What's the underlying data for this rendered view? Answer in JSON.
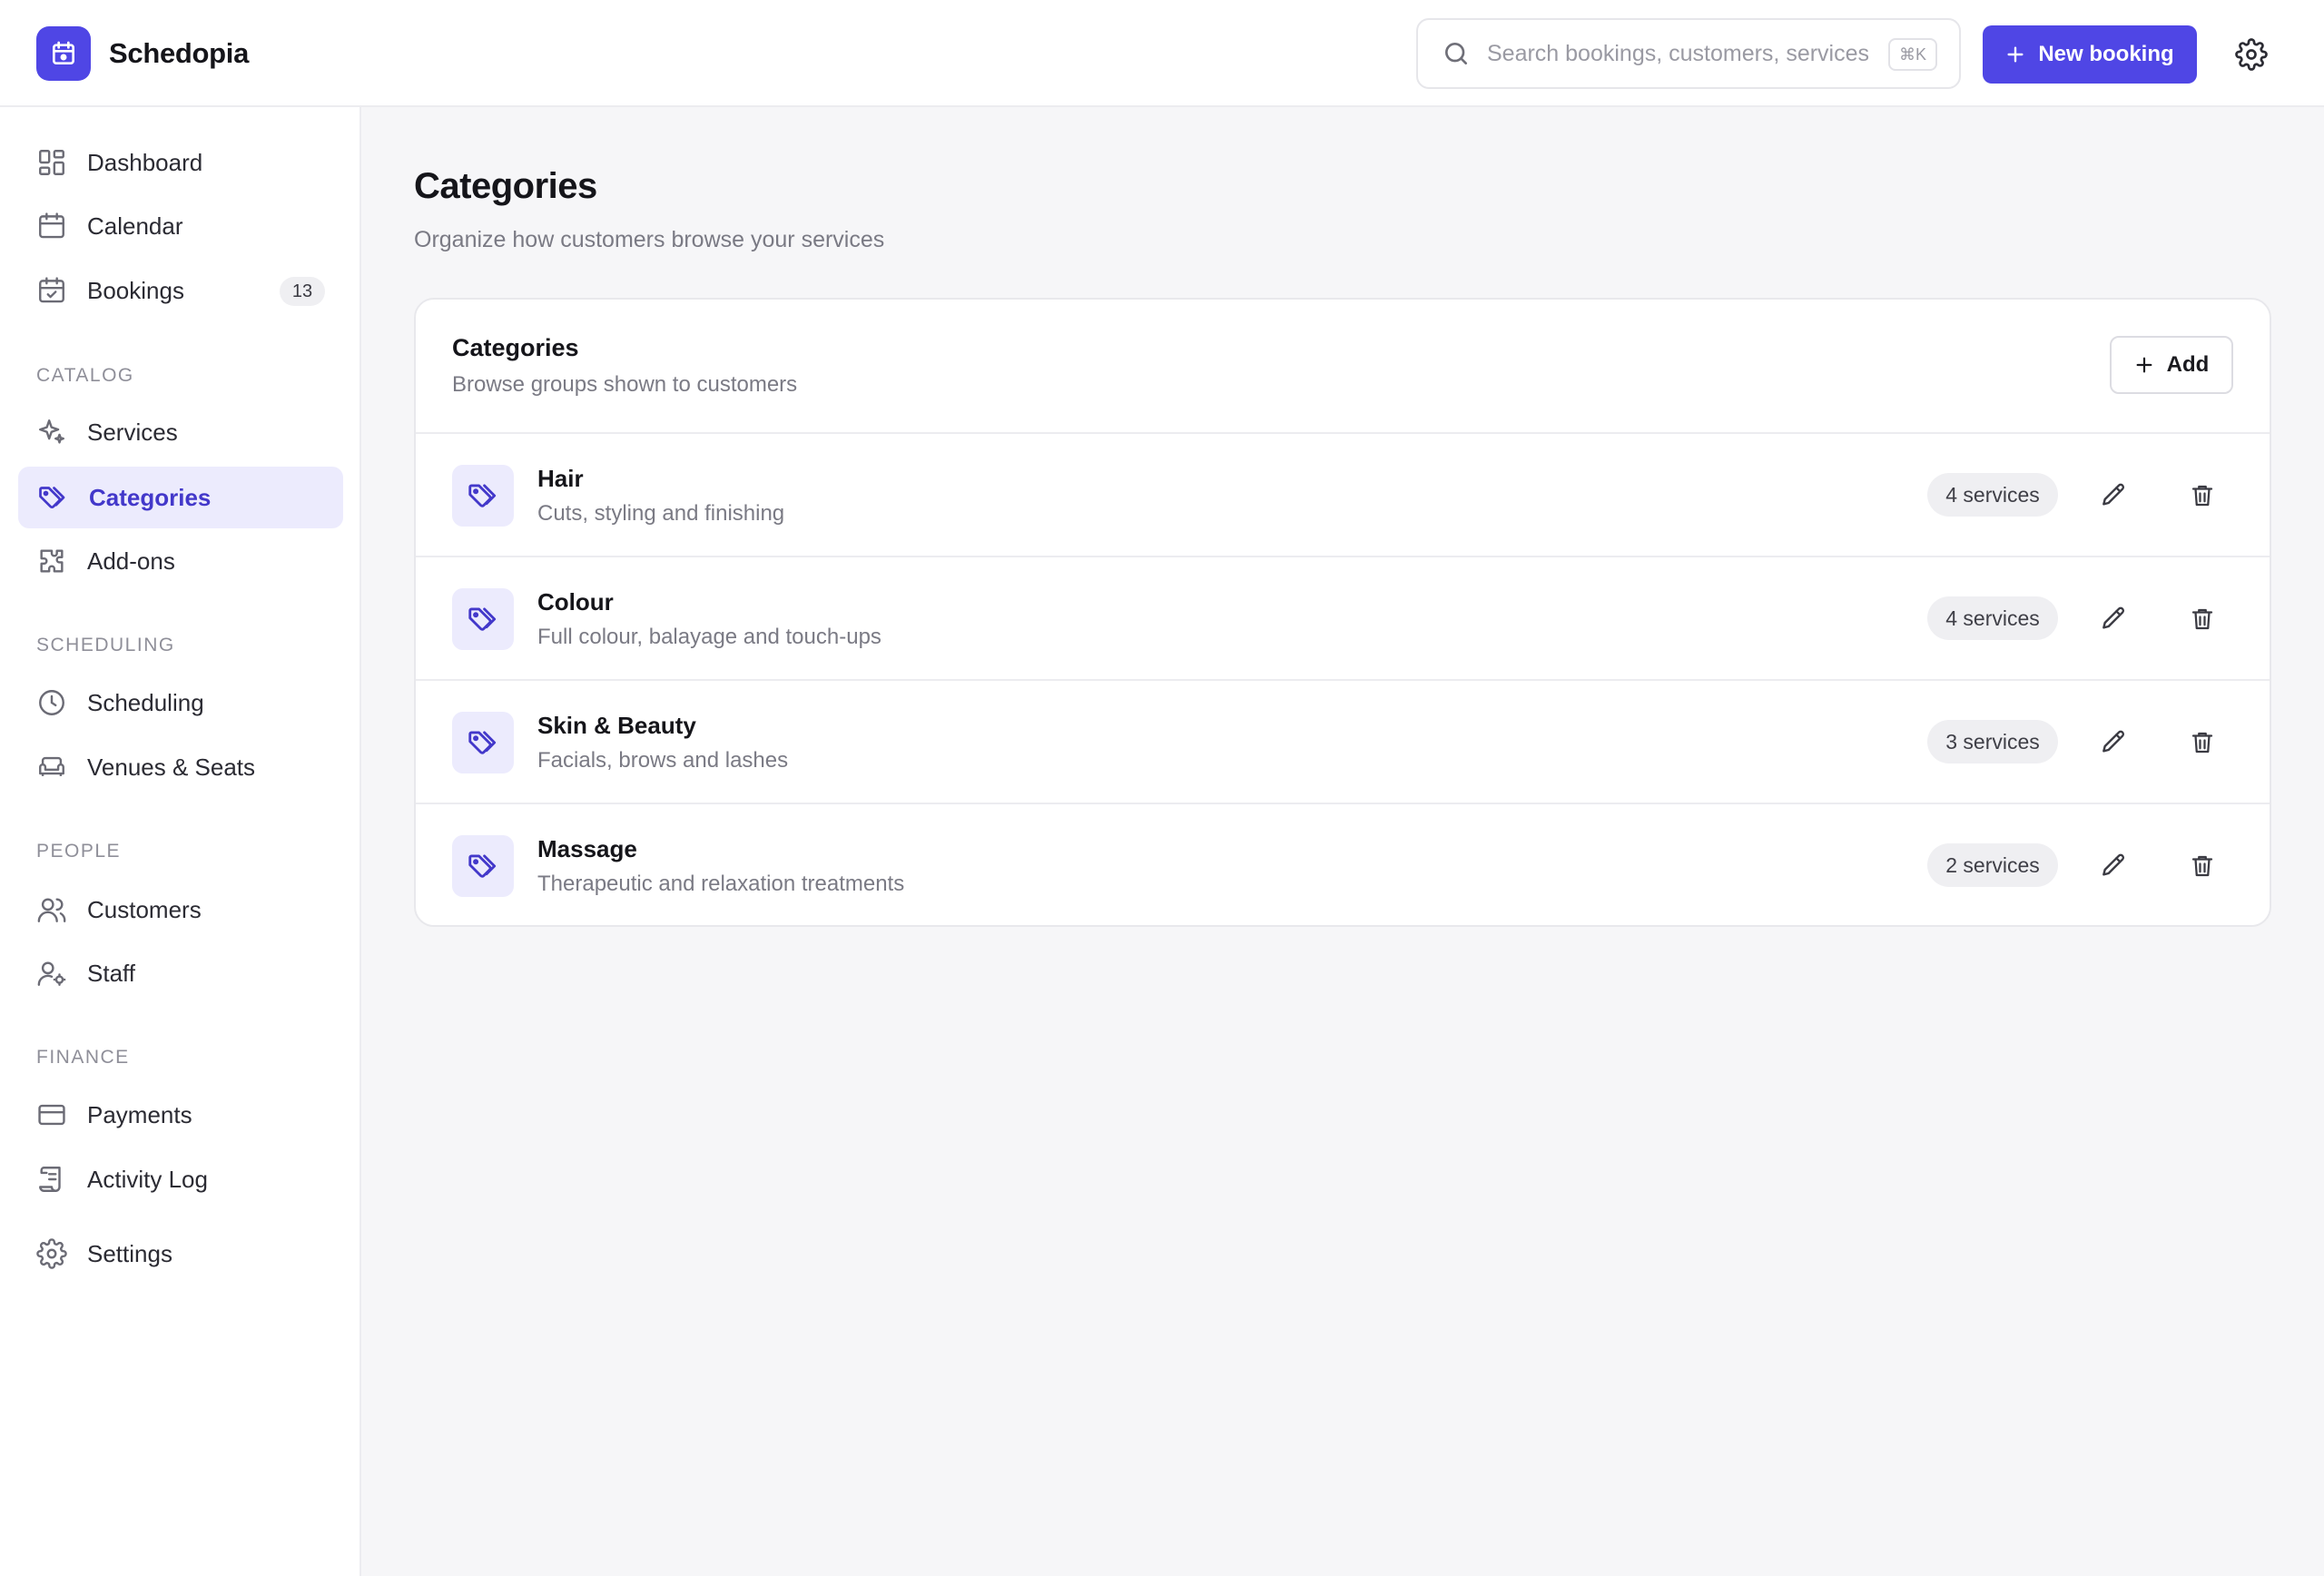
{
  "app": {
    "name": "Schedopia"
  },
  "colors": {
    "accent": "#4f46e5",
    "accent_soft": "#ecebfd",
    "background": "#f6f6f8"
  },
  "header": {
    "search_placeholder": "Search bookings, customers, services",
    "search_shortcut": "⌘K",
    "new_booking_label": "New booking"
  },
  "sidebar": {
    "items": [
      {
        "label": "Dashboard",
        "icon": "dashboard-icon"
      },
      {
        "label": "Calendar",
        "icon": "calendar-icon"
      },
      {
        "label": "Bookings",
        "icon": "calendar-check-icon",
        "badge": "13"
      }
    ],
    "catalog": {
      "label": "CATALOG",
      "items": [
        {
          "label": "Services",
          "icon": "sparkle-icon"
        },
        {
          "label": "Categories",
          "icon": "tags-icon",
          "active": true
        },
        {
          "label": "Add-ons",
          "icon": "puzzle-icon"
        }
      ]
    },
    "scheduling": {
      "label": "SCHEDULING",
      "items": [
        {
          "label": "Scheduling",
          "icon": "clock-icon"
        },
        {
          "label": "Venues & Seats",
          "icon": "sofa-icon"
        }
      ]
    },
    "people": {
      "label": "PEOPLE",
      "items": [
        {
          "label": "Customers",
          "icon": "users-icon"
        },
        {
          "label": "Staff",
          "icon": "user-cog-icon"
        }
      ]
    },
    "finance": {
      "label": "FINANCE",
      "items": [
        {
          "label": "Payments",
          "icon": "credit-card-icon"
        },
        {
          "label": "Activity Log",
          "icon": "scroll-icon"
        }
      ]
    },
    "settings": {
      "label": "Settings",
      "icon": "gear-icon"
    }
  },
  "page": {
    "title": "Categories",
    "subtitle": "Organize how customers browse your services"
  },
  "card": {
    "title": "Categories",
    "subtitle": "Browse groups shown to customers",
    "add_label": "Add",
    "rows": [
      {
        "name": "Hair",
        "description": "Cuts, styling and finishing",
        "count": "4 services"
      },
      {
        "name": "Colour",
        "description": "Full colour, balayage and touch-ups",
        "count": "4 services"
      },
      {
        "name": "Skin & Beauty",
        "description": "Facials, brows and lashes",
        "count": "3 services"
      },
      {
        "name": "Massage",
        "description": "Therapeutic and relaxation treatments",
        "count": "2 services"
      }
    ]
  }
}
